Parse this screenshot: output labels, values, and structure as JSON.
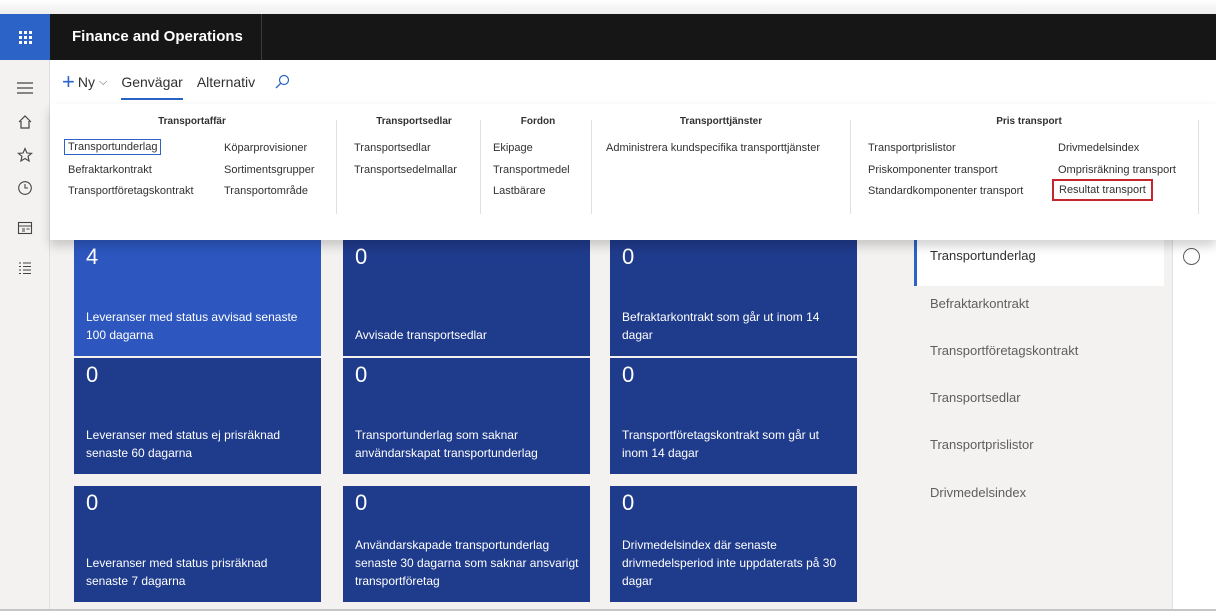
{
  "app": {
    "title": "Finance and Operations"
  },
  "actionbar": {
    "new_label": "Ny",
    "tabs": [
      "Genvägar",
      "Alternativ"
    ]
  },
  "menu": {
    "groups": [
      {
        "title": "Transportaffär",
        "links": [
          "Transportunderlag",
          "Befraktarkontrakt",
          "Transportföretagskontrakt",
          "Köparprovisioner",
          "Sortimentsgrupper",
          "Transportområde"
        ]
      },
      {
        "title": "Transportsedlar",
        "links": [
          "Transportsedlar",
          "Transportsedelmallar"
        ]
      },
      {
        "title": "Fordon",
        "links": [
          "Ekipage",
          "Transportmedel",
          "Lastbärare"
        ]
      },
      {
        "title": "Transporttjänster",
        "links": [
          "Administrera kundspecifika transporttjänster"
        ]
      },
      {
        "title": "Pris transport",
        "links": [
          "Transportprislistor",
          "Priskomponenter transport",
          "Standardkomponenter transport",
          "Drivmedelsindex",
          "Omprisräkning transport",
          "Resultat transport"
        ]
      }
    ],
    "highlighted": "Resultat transport"
  },
  "tiles": [
    {
      "value": "4",
      "label": "Leveranser med status avvisad senaste 100 dagarna"
    },
    {
      "value": "0",
      "label": "Avvisade transportsedlar"
    },
    {
      "value": "0",
      "label": "Befraktarkontrakt som går ut inom 14 dagar"
    },
    {
      "value": "0",
      "label": "Leveranser med status ej prisräknad senaste 60 dagarna"
    },
    {
      "value": "0",
      "label": "Transportunderlag som saknar användarskapat transportunderlag"
    },
    {
      "value": "0",
      "label": "Transportföretagskontrakt som går ut inom 14 dagar"
    },
    {
      "value": "0",
      "label": "Leveranser med status prisräknad senaste 7 dagarna"
    },
    {
      "value": "0",
      "label": "Användarskapade transportunderlag senaste 30 dagarna som saknar ansvarigt transportföretag"
    },
    {
      "value": "0",
      "label": "Drivmedelsindex där senaste drivmedelsperiod inte uppdaterats på 30 dagar"
    }
  ],
  "rightlist": {
    "items": [
      "Transportunderlag",
      "Befraktarkontrakt",
      "Transportföretagskontrakt",
      "Transportsedlar",
      "Transportprislistor",
      "Drivmedelsindex"
    ],
    "active": "Transportunderlag"
  },
  "colors": {
    "tile": "#1f3b8c",
    "tile_highlight": "#2d57bf",
    "accent": "#2b63c6",
    "highlight_border": "#c4262e"
  },
  "icons": [
    "waffle-icon",
    "hamburger-icon",
    "home-icon",
    "star-icon",
    "clock-icon",
    "workspace-icon",
    "list-icon",
    "search-icon",
    "chevron-down-icon"
  ]
}
